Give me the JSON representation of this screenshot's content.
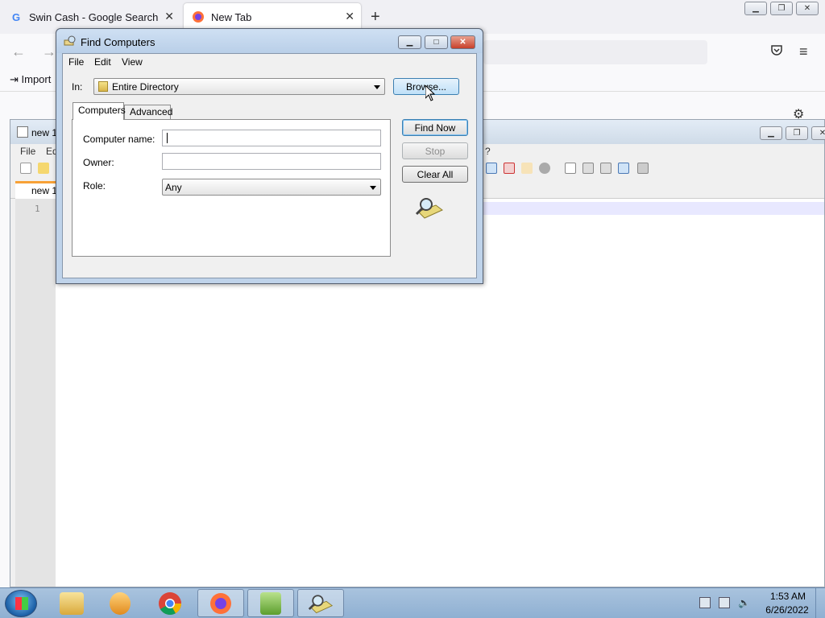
{
  "firefox": {
    "tabs": [
      {
        "label": "Swin Cash - Google Search",
        "icon": "google-icon"
      },
      {
        "label": "New Tab",
        "icon": "firefox-icon"
      }
    ],
    "newtab_symbol": "+",
    "bookmarks_import_label": "Import",
    "icons": [
      "back-arrow-icon",
      "forward-arrow-icon",
      "pocket-icon",
      "hamburger-menu-icon",
      "gear-icon"
    ]
  },
  "notepadpp": {
    "title": "new 1",
    "menu": [
      "File",
      "Ed"
    ],
    "menu_help": "?",
    "tab_label": "new 1",
    "line_number": "1"
  },
  "dialog": {
    "title": "Find Computers",
    "menu": [
      "File",
      "Edit",
      "View"
    ],
    "in_label": "In:",
    "in_value": "Entire Directory",
    "browse_label": "Browse...",
    "tabs": [
      "Computers",
      "Advanced"
    ],
    "fields": {
      "computer_name_label": "Computer name:",
      "computer_name_value": "",
      "owner_label": "Owner:",
      "owner_value": "",
      "role_label": "Role:",
      "role_value": "Any"
    },
    "buttons": {
      "find_now": "Find Now",
      "stop": "Stop",
      "clear_all": "Clear All"
    }
  },
  "taskbar": {
    "apps": [
      "explorer-icon",
      "media-player-icon",
      "chrome-icon",
      "firefox-icon",
      "notepadpp-icon",
      "find-computers-icon"
    ],
    "clock_time": "1:53 AM",
    "clock_date": "6/26/2022"
  }
}
